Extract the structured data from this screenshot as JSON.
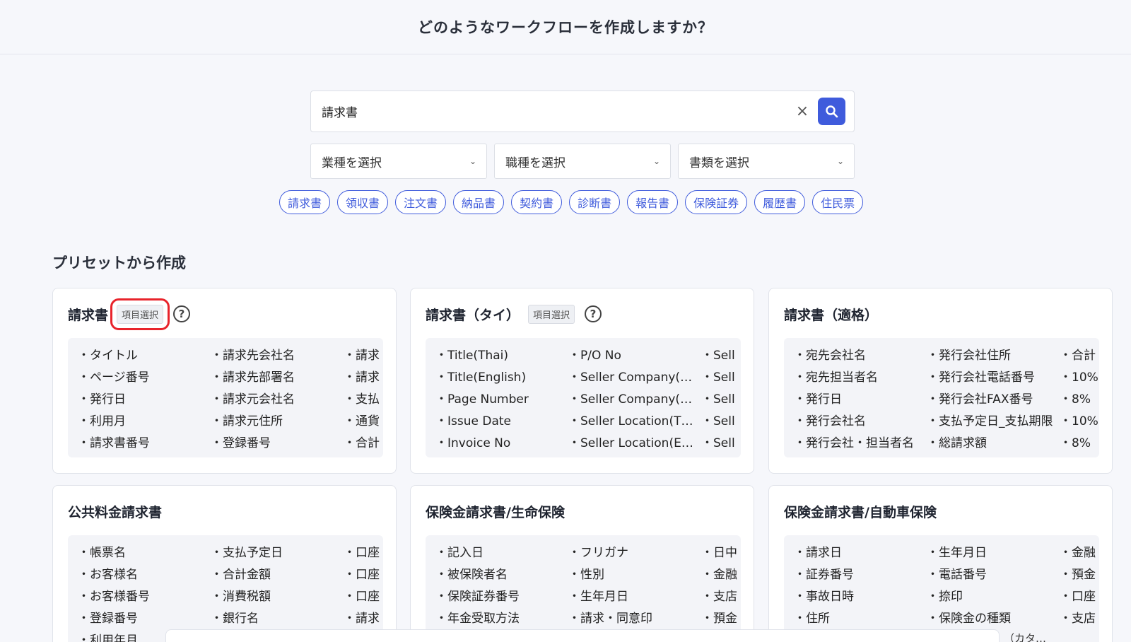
{
  "header": {
    "title": "どのようなワークフローを作成しますか？"
  },
  "search": {
    "value": "請求書",
    "clear_icon": "×"
  },
  "filters": [
    {
      "label": "業種を選択"
    },
    {
      "label": "職種を選択"
    },
    {
      "label": "書類を選択"
    }
  ],
  "chips": [
    "請求書",
    "領収書",
    "注文書",
    "納品書",
    "契約書",
    "診断書",
    "報告書",
    "保険証券",
    "履歴書",
    "住民票"
  ],
  "section": {
    "title": "プリセットから作成"
  },
  "cards": [
    {
      "title": "請求書",
      "tag": "項目選択",
      "help": "?",
      "cols": [
        [
          "・タイトル",
          "・ページ番号",
          "・発行日",
          "・利用月",
          "・請求書番号"
        ],
        [
          "・請求先会社名",
          "・請求先部署名",
          "・請求元会社名",
          "・請求元住所",
          "・登録番号"
        ],
        [
          "・請求",
          "・請求",
          "・支払",
          "・通貨",
          "・合計"
        ]
      ]
    },
    {
      "title": "請求書（タイ）",
      "tag": "項目選択",
      "help": "?",
      "cols": [
        [
          "・Title(Thai)",
          "・Title(English)",
          "・Page Number",
          "・Issue Date",
          "・Invoice No"
        ],
        [
          "・P/O No",
          "・Seller Company(T…",
          "・Seller Company(E…",
          "・Seller Location(Th…",
          "・Seller Location(En…"
        ],
        [
          "・Sell",
          "・Sell",
          "・Sell",
          "・Sell",
          "・Sell"
        ]
      ]
    },
    {
      "title": "請求書（適格）",
      "cols": [
        [
          "・宛先会社名",
          "・宛先担当者名",
          "・発行日",
          "・発行会社名",
          "・発行会社・担当者名"
        ],
        [
          "・発行会社住所",
          "・発行会社電話番号",
          "・発行会社FAX番号",
          "・支払予定日_支払期限",
          "・総請求額"
        ],
        [
          "・合計",
          "・10%",
          "・8%",
          "・10%",
          "・8%"
        ]
      ]
    },
    {
      "title": "公共料金請求書",
      "cols": [
        [
          "・帳票名",
          "・お客様名",
          "・お客様番号",
          "・登録番号",
          "・利用年月"
        ],
        [
          "・支払予定日",
          "・合計金額",
          "・消費税額",
          "・銀行名",
          ""
        ],
        [
          "・口座",
          "・口座",
          "・口座",
          "・請求",
          ""
        ]
      ]
    },
    {
      "title": "保険金請求書/生命保険",
      "cols": [
        [
          "・記入日",
          "・被保険者名",
          "・保険証券番号",
          "・年金受取方法",
          ""
        ],
        [
          "・フリガナ",
          "・性別",
          "・生年月日",
          "・請求・同意印",
          ""
        ],
        [
          "・日中",
          "・金融",
          "・支店",
          "・預金",
          ""
        ]
      ]
    },
    {
      "title": "保険金請求書/自動車保険",
      "cols": [
        [
          "・請求日",
          "・証券番号",
          "・事故日時",
          "・住所",
          ""
        ],
        [
          "・生年月日",
          "・電話番号",
          "・捺印",
          "・保険金の種類",
          ""
        ],
        [
          "・金融",
          "・預金",
          "・口座",
          "・支店",
          ""
        ]
      ]
    }
  ],
  "bottom_text": "（カタ…"
}
